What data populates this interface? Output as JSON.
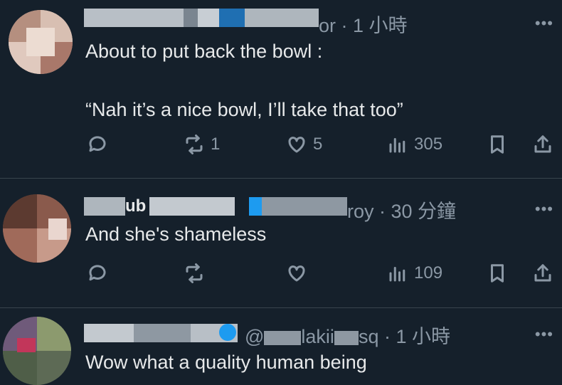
{
  "posts": [
    {
      "handle_tail": "or",
      "time": "1 小時",
      "text": "About to put back the bowl :\n\n“Nah it’s a nice bowl, I’ll take that too”",
      "replies": "",
      "reposts": "1",
      "likes": "5",
      "views": "305",
      "more": "•••"
    },
    {
      "name_fragment": "ub",
      "handle_tail": "roy",
      "time": "30 分鐘",
      "text": "And she's shameless",
      "replies": "",
      "reposts": "",
      "likes": "",
      "views": "109",
      "more": "•••"
    },
    {
      "handle_at": "@",
      "handle_mid": "lakii",
      "handle_tail": "sq",
      "time": "1 小時",
      "text": "Wow what a quality human being",
      "more": "•••"
    }
  ],
  "colors": {
    "background": "#15202b",
    "text": "#e7e9ea",
    "muted": "#8b98a5",
    "verified": "#1d9bf0"
  },
  "icons": [
    "reply-icon",
    "repost-icon",
    "like-icon",
    "views-icon",
    "bookmark-icon",
    "share-icon",
    "more-icon",
    "verified-badge-icon"
  ]
}
